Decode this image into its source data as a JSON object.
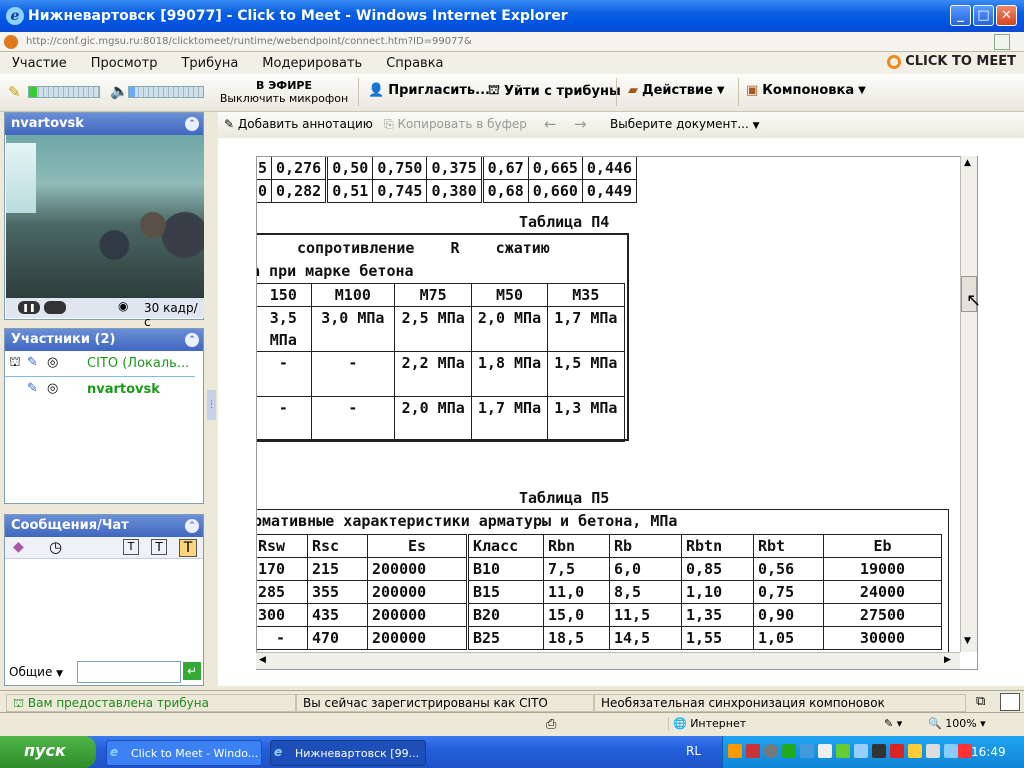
{
  "window": {
    "title": "Нижневартовск [99077] - Click to Meet - Windows Internet Explorer"
  },
  "address": {
    "url": "http://conf.gic.mgsu.ru:8018/clicktomeet/runtime/webendpoint/connect.htm?ID=99077&"
  },
  "menu": [
    "Участие",
    "Просмотр",
    "Трибуна",
    "Модерировать",
    "Справка"
  ],
  "brand": "CLICK TO MEET",
  "toolbar": {
    "on_air": "В ЭФИРЕ",
    "mute_mic": "Выключить микрофон",
    "invite": "Пригласить...",
    "leave_podium": "Уйти с трибуны",
    "action": "Действие",
    "layout": "Компоновка"
  },
  "video_panel": {
    "title": "nvartovsk",
    "fps": "30  кадр/с"
  },
  "participants": {
    "title": "Участники (2)",
    "items": [
      {
        "name": "CITO (Локаль...",
        "color": "#1a9a1a"
      },
      {
        "name": "nvartovsk",
        "color": "#1a9a1a"
      }
    ]
  },
  "chat": {
    "title": "Сообщения/Чат",
    "recipient": "Общие",
    "input_placeholder": ""
  },
  "content_toolbar": {
    "add_annotation": "Добавить аннотацию",
    "copy_buffer": "Копировать в буфер",
    "select_document": "Выберите документ..."
  },
  "doc": {
    "top_rows": [
      [
        "5",
        "0,276",
        "0,50",
        "0,750",
        "0,375",
        "0,67",
        "0,665",
        "0,446"
      ],
      [
        "0",
        "0,282",
        "0,51",
        "0,745",
        "0,380",
        "0,68",
        "0,660",
        "0,449"
      ]
    ],
    "table4": {
      "caption": "Таблица П4",
      "header1": "сопротивление    R    сжатию",
      "header2": "а при марке бетона",
      "cols": [
        "150",
        "М100",
        "М75",
        "М50",
        "М35"
      ],
      "rows": [
        [
          "3,5 МПа",
          "3,0 МПа",
          "2,5 МПа",
          "2,0 МПа",
          "1,7 МПа"
        ],
        [
          "-",
          "-",
          "2,2 МПа",
          "1,8 МПа",
          "1,5 МПа"
        ],
        [
          "-",
          "-",
          "2,0 МПа",
          "1,7 МПа",
          "1,3 МПа"
        ]
      ]
    },
    "table5": {
      "caption": "Таблица П5",
      "header": "рмативные характеристики арматуры и бетона, МПа",
      "cols": [
        "Rsw",
        "Rsc",
        "Es",
        "Класс",
        "Rbn",
        "Rb",
        "Rbtn",
        "Rbt",
        "Eb"
      ],
      "rows": [
        [
          "170",
          "215",
          "200000",
          "В10",
          "7,5",
          "6,0",
          "0,85",
          "0,56",
          "19000"
        ],
        [
          "285",
          "355",
          "200000",
          "В15",
          "11,0",
          "8,5",
          "1,10",
          "0,75",
          "24000"
        ],
        [
          "300",
          "435",
          "200000",
          "В20",
          "15,0",
          "11,5",
          "1,35",
          "0,90",
          "27500"
        ],
        [
          "-",
          "470",
          "200000",
          "В25",
          "18,5",
          "14,5",
          "1,55",
          "1,05",
          "30000"
        ]
      ]
    }
  },
  "status": {
    "podium": "Вам предоставлена трибуна",
    "registered": "Вы сейчас зарегистрированы как CITO",
    "sync": "Необязательная синхронизация компоновок",
    "zone": "Интернет",
    "zoom": "100%"
  },
  "taskbar": {
    "start": "пуск",
    "tasks": [
      "Click to Meet - Windo...",
      "Нижневартовск [99..."
    ],
    "lang": "RL",
    "time": "16:49"
  }
}
